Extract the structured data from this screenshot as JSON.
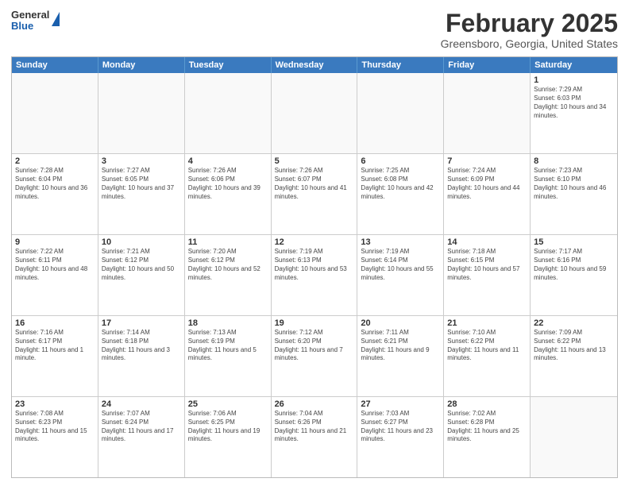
{
  "header": {
    "logo": {
      "line1": "General",
      "line2": "Blue"
    },
    "title": "February 2025",
    "subtitle": "Greensboro, Georgia, United States"
  },
  "weekdays": [
    "Sunday",
    "Monday",
    "Tuesday",
    "Wednesday",
    "Thursday",
    "Friday",
    "Saturday"
  ],
  "rows": [
    [
      {
        "day": "",
        "info": ""
      },
      {
        "day": "",
        "info": ""
      },
      {
        "day": "",
        "info": ""
      },
      {
        "day": "",
        "info": ""
      },
      {
        "day": "",
        "info": ""
      },
      {
        "day": "",
        "info": ""
      },
      {
        "day": "1",
        "info": "Sunrise: 7:29 AM\nSunset: 6:03 PM\nDaylight: 10 hours and 34 minutes."
      }
    ],
    [
      {
        "day": "2",
        "info": "Sunrise: 7:28 AM\nSunset: 6:04 PM\nDaylight: 10 hours and 36 minutes."
      },
      {
        "day": "3",
        "info": "Sunrise: 7:27 AM\nSunset: 6:05 PM\nDaylight: 10 hours and 37 minutes."
      },
      {
        "day": "4",
        "info": "Sunrise: 7:26 AM\nSunset: 6:06 PM\nDaylight: 10 hours and 39 minutes."
      },
      {
        "day": "5",
        "info": "Sunrise: 7:26 AM\nSunset: 6:07 PM\nDaylight: 10 hours and 41 minutes."
      },
      {
        "day": "6",
        "info": "Sunrise: 7:25 AM\nSunset: 6:08 PM\nDaylight: 10 hours and 42 minutes."
      },
      {
        "day": "7",
        "info": "Sunrise: 7:24 AM\nSunset: 6:09 PM\nDaylight: 10 hours and 44 minutes."
      },
      {
        "day": "8",
        "info": "Sunrise: 7:23 AM\nSunset: 6:10 PM\nDaylight: 10 hours and 46 minutes."
      }
    ],
    [
      {
        "day": "9",
        "info": "Sunrise: 7:22 AM\nSunset: 6:11 PM\nDaylight: 10 hours and 48 minutes."
      },
      {
        "day": "10",
        "info": "Sunrise: 7:21 AM\nSunset: 6:12 PM\nDaylight: 10 hours and 50 minutes."
      },
      {
        "day": "11",
        "info": "Sunrise: 7:20 AM\nSunset: 6:12 PM\nDaylight: 10 hours and 52 minutes."
      },
      {
        "day": "12",
        "info": "Sunrise: 7:19 AM\nSunset: 6:13 PM\nDaylight: 10 hours and 53 minutes."
      },
      {
        "day": "13",
        "info": "Sunrise: 7:19 AM\nSunset: 6:14 PM\nDaylight: 10 hours and 55 minutes."
      },
      {
        "day": "14",
        "info": "Sunrise: 7:18 AM\nSunset: 6:15 PM\nDaylight: 10 hours and 57 minutes."
      },
      {
        "day": "15",
        "info": "Sunrise: 7:17 AM\nSunset: 6:16 PM\nDaylight: 10 hours and 59 minutes."
      }
    ],
    [
      {
        "day": "16",
        "info": "Sunrise: 7:16 AM\nSunset: 6:17 PM\nDaylight: 11 hours and 1 minute."
      },
      {
        "day": "17",
        "info": "Sunrise: 7:14 AM\nSunset: 6:18 PM\nDaylight: 11 hours and 3 minutes."
      },
      {
        "day": "18",
        "info": "Sunrise: 7:13 AM\nSunset: 6:19 PM\nDaylight: 11 hours and 5 minutes."
      },
      {
        "day": "19",
        "info": "Sunrise: 7:12 AM\nSunset: 6:20 PM\nDaylight: 11 hours and 7 minutes."
      },
      {
        "day": "20",
        "info": "Sunrise: 7:11 AM\nSunset: 6:21 PM\nDaylight: 11 hours and 9 minutes."
      },
      {
        "day": "21",
        "info": "Sunrise: 7:10 AM\nSunset: 6:22 PM\nDaylight: 11 hours and 11 minutes."
      },
      {
        "day": "22",
        "info": "Sunrise: 7:09 AM\nSunset: 6:22 PM\nDaylight: 11 hours and 13 minutes."
      }
    ],
    [
      {
        "day": "23",
        "info": "Sunrise: 7:08 AM\nSunset: 6:23 PM\nDaylight: 11 hours and 15 minutes."
      },
      {
        "day": "24",
        "info": "Sunrise: 7:07 AM\nSunset: 6:24 PM\nDaylight: 11 hours and 17 minutes."
      },
      {
        "day": "25",
        "info": "Sunrise: 7:06 AM\nSunset: 6:25 PM\nDaylight: 11 hours and 19 minutes."
      },
      {
        "day": "26",
        "info": "Sunrise: 7:04 AM\nSunset: 6:26 PM\nDaylight: 11 hours and 21 minutes."
      },
      {
        "day": "27",
        "info": "Sunrise: 7:03 AM\nSunset: 6:27 PM\nDaylight: 11 hours and 23 minutes."
      },
      {
        "day": "28",
        "info": "Sunrise: 7:02 AM\nSunset: 6:28 PM\nDaylight: 11 hours and 25 minutes."
      },
      {
        "day": "",
        "info": ""
      }
    ]
  ]
}
